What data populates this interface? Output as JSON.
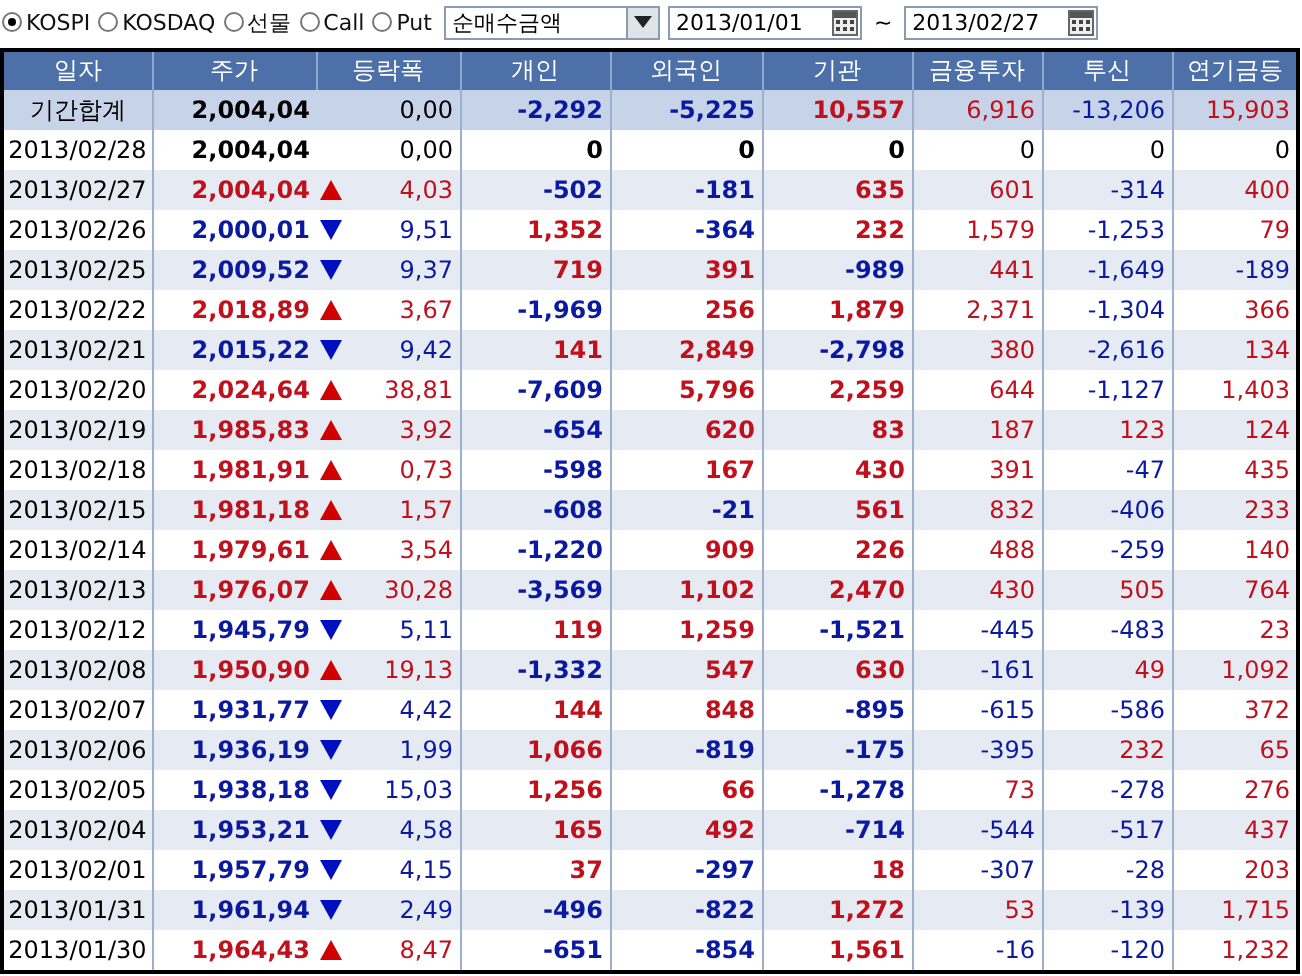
{
  "toolbar": {
    "markets": [
      {
        "label": "KOSPI",
        "selected": true
      },
      {
        "label": "KOSDAQ",
        "selected": false
      },
      {
        "label": "선물",
        "selected": false
      },
      {
        "label": "Call",
        "selected": false
      },
      {
        "label": "Put",
        "selected": false
      }
    ],
    "measure": {
      "value": "순매수금액"
    },
    "date_from": {
      "value": "2013/01/01"
    },
    "range_separator": "~",
    "date_to": {
      "value": "2013/02/27"
    }
  },
  "table": {
    "columns": [
      "일자",
      "주가",
      "등락폭",
      "개인",
      "외국인",
      "기관",
      "금융투자",
      "투신",
      "연기금등"
    ],
    "rows": [
      {
        "kind": "total",
        "date": "기간합계",
        "price": "2,004,04",
        "up": false,
        "down": false,
        "change": "0,00",
        "values": [
          "-2,292",
          "-5,225",
          "10,557",
          "6,916",
          "-13,206",
          "15,903"
        ]
      },
      {
        "kind": "day",
        "date": "2013/02/28",
        "price": "2,004,04",
        "up": false,
        "down": false,
        "change": "0,00",
        "values": [
          "0",
          "0",
          "0",
          "0",
          "0",
          "0"
        ]
      },
      {
        "kind": "day",
        "date": "2013/02/27",
        "price": "2,004,04",
        "up": true,
        "down": false,
        "change": "4,03",
        "values": [
          "-502",
          "-181",
          "635",
          "601",
          "-314",
          "400"
        ]
      },
      {
        "kind": "day",
        "date": "2013/02/26",
        "price": "2,000,01",
        "up": false,
        "down": true,
        "change": "9,51",
        "values": [
          "1,352",
          "-364",
          "232",
          "1,579",
          "-1,253",
          "79"
        ]
      },
      {
        "kind": "day",
        "date": "2013/02/25",
        "price": "2,009,52",
        "up": false,
        "down": true,
        "change": "9,37",
        "values": [
          "719",
          "391",
          "-989",
          "441",
          "-1,649",
          "-189"
        ]
      },
      {
        "kind": "day",
        "date": "2013/02/22",
        "price": "2,018,89",
        "up": true,
        "down": false,
        "change": "3,67",
        "values": [
          "-1,969",
          "256",
          "1,879",
          "2,371",
          "-1,304",
          "366"
        ]
      },
      {
        "kind": "day",
        "date": "2013/02/21",
        "price": "2,015,22",
        "up": false,
        "down": true,
        "change": "9,42",
        "values": [
          "141",
          "2,849",
          "-2,798",
          "380",
          "-2,616",
          "134"
        ]
      },
      {
        "kind": "day",
        "date": "2013/02/20",
        "price": "2,024,64",
        "up": true,
        "down": false,
        "change": "38,81",
        "values": [
          "-7,609",
          "5,796",
          "2,259",
          "644",
          "-1,127",
          "1,403"
        ]
      },
      {
        "kind": "day",
        "date": "2013/02/19",
        "price": "1,985,83",
        "up": true,
        "down": false,
        "change": "3,92",
        "values": [
          "-654",
          "620",
          "83",
          "187",
          "123",
          "124"
        ]
      },
      {
        "kind": "day",
        "date": "2013/02/18",
        "price": "1,981,91",
        "up": true,
        "down": false,
        "change": "0,73",
        "values": [
          "-598",
          "167",
          "430",
          "391",
          "-47",
          "435"
        ]
      },
      {
        "kind": "day",
        "date": "2013/02/15",
        "price": "1,981,18",
        "up": true,
        "down": false,
        "change": "1,57",
        "values": [
          "-608",
          "-21",
          "561",
          "832",
          "-406",
          "233"
        ]
      },
      {
        "kind": "day",
        "date": "2013/02/14",
        "price": "1,979,61",
        "up": true,
        "down": false,
        "change": "3,54",
        "values": [
          "-1,220",
          "909",
          "226",
          "488",
          "-259",
          "140"
        ]
      },
      {
        "kind": "day",
        "date": "2013/02/13",
        "price": "1,976,07",
        "up": true,
        "down": false,
        "change": "30,28",
        "values": [
          "-3,569",
          "1,102",
          "2,470",
          "430",
          "505",
          "764"
        ]
      },
      {
        "kind": "day",
        "date": "2013/02/12",
        "price": "1,945,79",
        "up": false,
        "down": true,
        "change": "5,11",
        "values": [
          "119",
          "1,259",
          "-1,521",
          "-445",
          "-483",
          "23"
        ]
      },
      {
        "kind": "day",
        "date": "2013/02/08",
        "price": "1,950,90",
        "up": true,
        "down": false,
        "change": "19,13",
        "values": [
          "-1,332",
          "547",
          "630",
          "-161",
          "49",
          "1,092"
        ]
      },
      {
        "kind": "day",
        "date": "2013/02/07",
        "price": "1,931,77",
        "up": false,
        "down": true,
        "change": "4,42",
        "values": [
          "144",
          "848",
          "-895",
          "-615",
          "-586",
          "372"
        ]
      },
      {
        "kind": "day",
        "date": "2013/02/06",
        "price": "1,936,19",
        "up": false,
        "down": true,
        "change": "1,99",
        "values": [
          "1,066",
          "-819",
          "-175",
          "-395",
          "232",
          "65"
        ]
      },
      {
        "kind": "day",
        "date": "2013/02/05",
        "price": "1,938,18",
        "up": false,
        "down": true,
        "change": "15,03",
        "values": [
          "1,256",
          "66",
          "-1,278",
          "73",
          "-278",
          "276"
        ]
      },
      {
        "kind": "day",
        "date": "2013/02/04",
        "price": "1,953,21",
        "up": false,
        "down": true,
        "change": "4,58",
        "values": [
          "165",
          "492",
          "-714",
          "-544",
          "-517",
          "437"
        ]
      },
      {
        "kind": "day",
        "date": "2013/02/01",
        "price": "1,957,79",
        "up": false,
        "down": true,
        "change": "4,15",
        "values": [
          "37",
          "-297",
          "18",
          "-307",
          "-28",
          "203"
        ]
      },
      {
        "kind": "day",
        "date": "2013/01/31",
        "price": "1,961,94",
        "up": false,
        "down": true,
        "change": "2,49",
        "values": [
          "-496",
          "-822",
          "1,272",
          "53",
          "-139",
          "1,715"
        ]
      },
      {
        "kind": "day",
        "date": "2013/01/30",
        "price": "1,964,43",
        "up": true,
        "down": false,
        "change": "8,47",
        "values": [
          "-651",
          "-854",
          "1,561",
          "-16",
          "-120",
          "1,232"
        ]
      }
    ]
  }
}
